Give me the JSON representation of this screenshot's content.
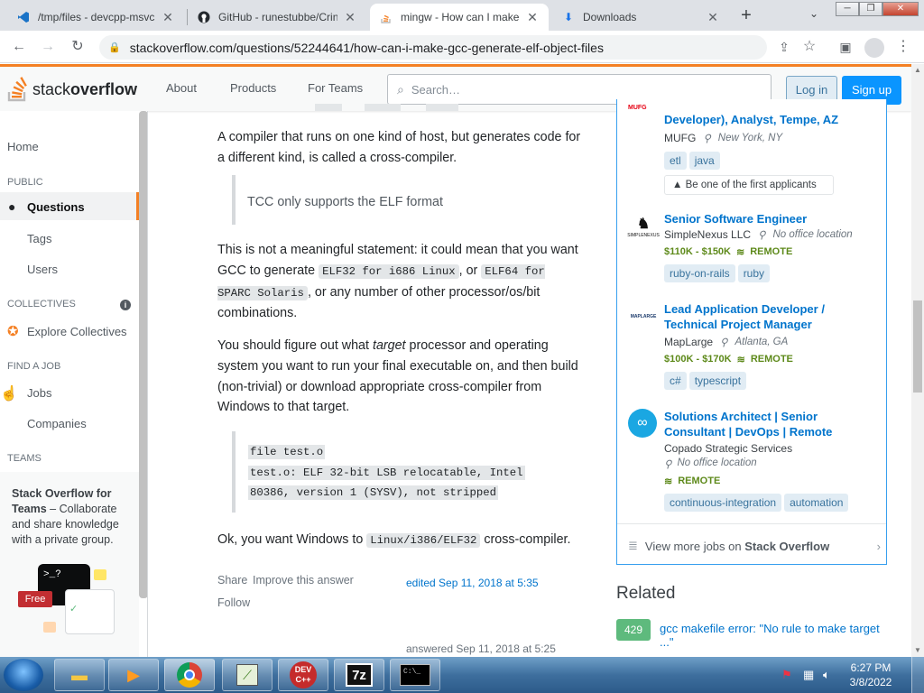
{
  "browser": {
    "tabs": [
      {
        "title": "/tmp/files - devcpp-msvc",
        "active": false
      },
      {
        "title": "GitHub - runestubbe/Crin",
        "active": false
      },
      {
        "title": "mingw - How can I make",
        "active": true
      },
      {
        "title": "Downloads",
        "active": false
      }
    ],
    "new_tab": "+",
    "url": "stackoverflow.com/questions/52244641/how-can-i-make-gcc-generate-elf-object-files"
  },
  "header": {
    "logo_stack": "stack",
    "logo_overflow": "overflow",
    "nav": [
      "About",
      "Products",
      "For Teams"
    ],
    "search_placeholder": "Search…",
    "login": "Log in",
    "signup": "Sign up"
  },
  "sidebar": {
    "home": "Home",
    "public": "PUBLIC",
    "questions": "Questions",
    "tags": "Tags",
    "users": "Users",
    "collectives": "COLLECTIVES",
    "explore_collectives": "Explore Collectives",
    "find_a_job": "FIND A JOB",
    "jobs": "Jobs",
    "companies": "Companies",
    "teams": "TEAMS",
    "teams_title": "Stack Overflow for Teams",
    "teams_desc": " – Collaborate and share knowledge with a private group.",
    "free_badge": "Free"
  },
  "answer": {
    "p1": "A compiler that runs on one kind of host, but generates code for a different kind, is called a cross-compiler.",
    "quote": "TCC only supports the ELF format",
    "p2_a": "This is not a meaningful statement: it could mean that you want GCC to generate ",
    "p2_code1": "ELF32 for i686 Linux",
    "p2_b": ", or ",
    "p2_code2": "ELF64 for SPARC Solaris",
    "p2_c": ", or any number of other processor/os/bit combinations.",
    "p3_a": "You should figure out what ",
    "p3_em": "target",
    "p3_b": " processor and operating system you want to run your final executable on, and then build (non-trivial) or download appropriate cross-compiler from Windows to that target.",
    "pre_lines": [
      "file test.o",
      "test.o: ELF 32-bit LSB relocatable, Intel",
      "80386, version 1 (SYSV), not stripped"
    ],
    "p4_a": "Ok, you want Windows to ",
    "p4_code": "Linux/i386/ELF32",
    "p4_b": " cross-compiler.",
    "share": "Share",
    "improve": "Improve this answer",
    "follow": "Follow",
    "edited": "edited Sep 11, 2018 at 5:35",
    "answered": "answered Sep 11, 2018 at 5:25"
  },
  "jobs": {
    "items": [
      {
        "title": "Developer), Analyst, Tempe, AZ",
        "company": "MUFG",
        "location": "New York, NY",
        "salary": "",
        "remote": "",
        "tags": [
          "etl",
          "java"
        ],
        "note": "Be one of the first applicants",
        "logo": "MUFG"
      },
      {
        "title": "Senior Software Engineer",
        "company": "SimpleNexus LLC",
        "location": "No office location",
        "salary": "$110K - $150K",
        "remote": "REMOTE",
        "tags": [
          "ruby-on-rails",
          "ruby"
        ],
        "note": "",
        "logo": "SIMPLENEXUS"
      },
      {
        "title": "Lead Application Developer / Technical Project Manager",
        "company": "MapLarge",
        "location": "Atlanta, GA",
        "salary": "$100K - $170K",
        "remote": "REMOTE",
        "tags": [
          "c#",
          "typescript"
        ],
        "note": "",
        "logo": "MAPLARGE"
      },
      {
        "title": "Solutions Architect | Senior Consultant | DevOps | Remote",
        "company": "Copado Strategic Services",
        "location": "No office location",
        "salary": "",
        "remote": "REMOTE",
        "tags": [
          "continuous-integration",
          "automation"
        ],
        "note": "",
        "logo": ""
      }
    ],
    "view_more_a": "View more jobs on ",
    "view_more_b": "Stack Overflow"
  },
  "related": {
    "title": "Related",
    "items": [
      {
        "score": "429",
        "text": "gcc makefile error: \"No rule to make target ...\""
      }
    ]
  },
  "taskbar": {
    "time": "6:27 PM",
    "date": "3/8/2022"
  },
  "colors": {
    "so_orange": "#f48024",
    "link_blue": "#0074cc",
    "signup_blue": "#0a95ff",
    "remote_green": "#5e8a1b"
  }
}
